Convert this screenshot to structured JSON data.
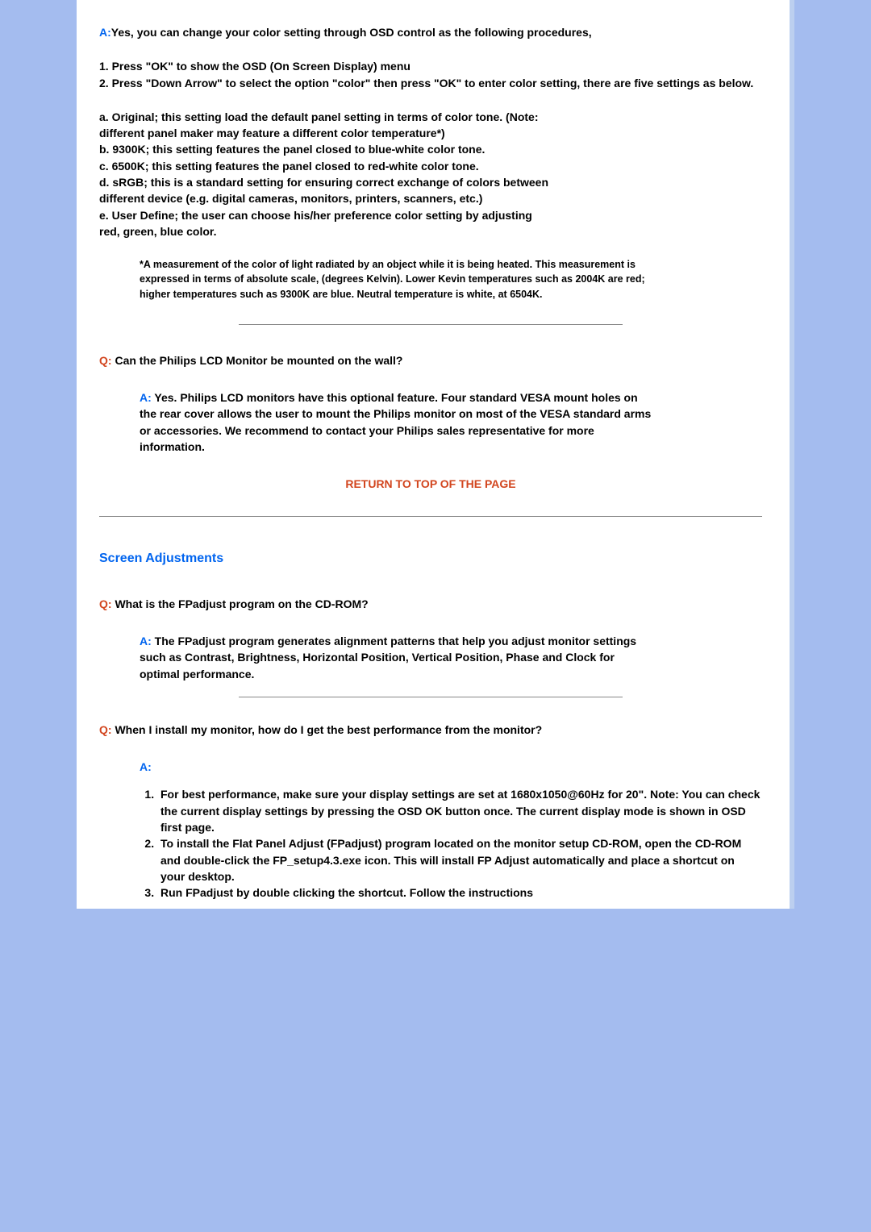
{
  "qa1": {
    "a_label": "A:",
    "a_text": "Yes, you can change your color setting through OSD control as the following procedures,",
    "steps_1": "1. Press \"OK\" to show the OSD (On Screen Display) menu",
    "steps_2": "2. Press \"Down Arrow\" to select the option \"color\" then press \"OK\" to enter color setting, there are five settings as below.",
    "opt_a": "a. Original; this setting load the default panel setting in terms of color tone. (Note: different panel maker may feature a different color temperature*)",
    "opt_b": "b. 9300K; this setting features the panel closed to blue-white color tone.",
    "opt_c": "c. 6500K; this setting features the panel closed to red-white color tone.",
    "opt_d": "d. sRGB; this is a standard setting for ensuring correct exchange of colors between different device (e.g. digital cameras, monitors, printers, scanners, etc.)",
    "opt_e": "e. User Define; the user can choose his/her preference color setting by adjusting red, green, blue color.",
    "footnote": "*A measurement of the color of light radiated by an object while it is being heated. This measurement is expressed in terms of absolute scale, (degrees Kelvin). Lower Kevin temperatures such as 2004K are red; higher temperatures such as 9300K are blue. Neutral temperature is white, at 6504K."
  },
  "qa2": {
    "q_label": "Q:",
    "q_text": "Can the Philips LCD Monitor be mounted on the wall?",
    "a_label": "A:",
    "a_text": "Yes. Philips LCD monitors have this optional feature. Four standard VESA mount holes on the rear cover allows the user to mount the Philips monitor on most of the VESA standard arms or accessories. We recommend to contact your Philips sales representative for more information."
  },
  "return_link": "RETURN TO TOP OF THE PAGE",
  "section": {
    "title": "Screen Adjustments"
  },
  "qa3": {
    "q_label": "Q:",
    "q_text": "What is the FPadjust program on the CD-ROM?",
    "a_label": "A:",
    "a_text": "The FPadjust program generates alignment patterns that help you adjust monitor settings such as Contrast, Brightness, Horizontal Position, Vertical Position, Phase and Clock for optimal performance."
  },
  "qa4": {
    "q_label": "Q:",
    "q_text": "When I install my monitor, how do I get the best performance from the monitor?",
    "a_label": "A:",
    "li1": "For best performance, make sure your display settings are set at 1680x1050@60Hz for 20\". Note: You can check the current display settings by pressing the OSD OK button once. The current display mode is shown in OSD first page.",
    "li2": "To install the Flat Panel Adjust (FPadjust) program located on the monitor setup CD-ROM, open the CD-ROM and double-click the FP_setup4.3.exe icon. This will install FP Adjust automatically and place a shortcut on your desktop.",
    "li3": "Run FPadjust by double clicking the shortcut. Follow the instructions"
  }
}
